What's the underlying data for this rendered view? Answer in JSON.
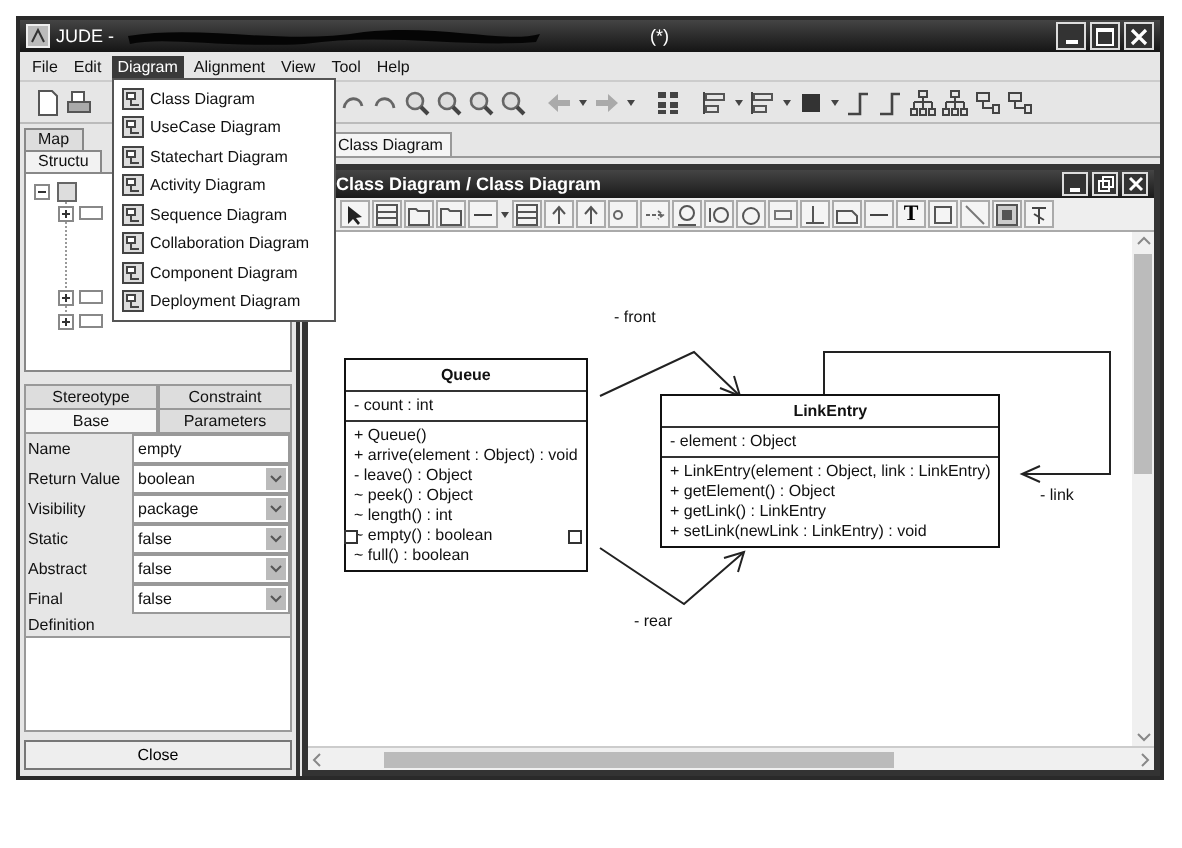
{
  "window": {
    "title": "JUDE -",
    "modified_mark": "(*)"
  },
  "menu": [
    {
      "label": "File",
      "selected": false
    },
    {
      "label": "Edit",
      "selected": false
    },
    {
      "label": "Diagram",
      "selected": true
    },
    {
      "label": "Alignment",
      "selected": false
    },
    {
      "label": "View",
      "selected": false
    },
    {
      "label": "Tool",
      "selected": false
    },
    {
      "label": "Help",
      "selected": false
    }
  ],
  "diagram_menu": [
    "Class Diagram",
    "UseCase Diagram",
    "Statechart Diagram",
    "Activity Diagram",
    "Sequence Diagram",
    "Collaboration Diagram",
    "Component Diagram",
    "Deployment Diagram"
  ],
  "left_tabs": [
    {
      "label": "Map",
      "selected": false
    },
    {
      "label": "Structu",
      "selected": true
    }
  ],
  "property_tabs": [
    {
      "label": "Stereotype",
      "selected": false
    },
    {
      "label": "Constraint",
      "selected": false
    },
    {
      "label": "Base",
      "selected": true
    },
    {
      "label": "Parameters",
      "selected": false
    }
  ],
  "properties": [
    {
      "label": "Name",
      "value": "empty",
      "kind": "text"
    },
    {
      "label": "Return Value",
      "value": "boolean",
      "kind": "select"
    },
    {
      "label": "Visibility",
      "value": "package",
      "kind": "select"
    },
    {
      "label": "Static",
      "value": "false",
      "kind": "select"
    },
    {
      "label": "Abstract",
      "value": "false",
      "kind": "select"
    },
    {
      "label": "Final",
      "value": "false",
      "kind": "select"
    }
  ],
  "definition_label": "Definition",
  "close_button": "Close",
  "document_tab": {
    "label": "Class Diagram"
  },
  "diagram_window": {
    "title": "Class Diagram / Class Diagram"
  },
  "diagram_toolbar": {
    "text_tool": "T"
  },
  "classes": [
    {
      "name": "Queue",
      "attributes": [
        "- count : int"
      ],
      "operations": [
        {
          "text": "+ Queue()",
          "selected": false
        },
        {
          "text": "+ arrive(element : Object) : void",
          "selected": false
        },
        {
          "text": "- leave() : Object",
          "selected": false
        },
        {
          "text": "~ peek() : Object",
          "selected": false
        },
        {
          "text": "~ length() : int",
          "selected": false
        },
        {
          "text": "~ empty() : boolean",
          "selected": true
        },
        {
          "text": "~ full() : boolean",
          "selected": false
        }
      ]
    },
    {
      "name": "LinkEntry",
      "attributes": [
        "- element : Object"
      ],
      "operations": [
        {
          "text": "+ LinkEntry(element : Object, link : LinkEntry)",
          "selected": false
        },
        {
          "text": "+ getElement() : Object",
          "selected": false
        },
        {
          "text": "+ getLink() : LinkEntry",
          "selected": false
        },
        {
          "text": "+ setLink(newLink : LinkEntry) : void",
          "selected": false
        }
      ]
    }
  ],
  "associations": [
    {
      "role": "- front"
    },
    {
      "role": "- rear"
    },
    {
      "role": "- link"
    }
  ]
}
